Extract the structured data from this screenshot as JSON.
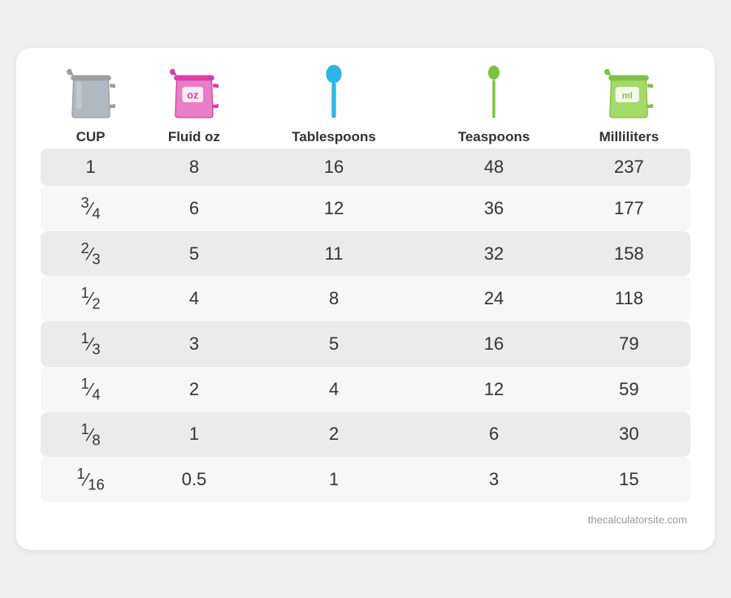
{
  "header": {
    "columns": [
      {
        "label": "CUP",
        "icon": "cup-icon"
      },
      {
        "label": "Fluid oz",
        "icon": "floz-icon"
      },
      {
        "label": "Tablespoons",
        "icon": "tablespoon-icon"
      },
      {
        "label": "Teaspoons",
        "icon": "teaspoon-icon"
      },
      {
        "label": "Milliliters",
        "icon": "milliliters-icon"
      }
    ]
  },
  "rows": [
    {
      "cup": "1",
      "floz": "8",
      "tbsp": "16",
      "tsp": "48",
      "ml": "237"
    },
    {
      "cup": "¾",
      "floz": "6",
      "tbsp": "12",
      "tsp": "36",
      "ml": "177"
    },
    {
      "cup": "⅔",
      "floz": "5",
      "tbsp": "11",
      "tsp": "32",
      "ml": "158"
    },
    {
      "cup": "½",
      "floz": "4",
      "tbsp": "8",
      "tsp": "24",
      "ml": "118"
    },
    {
      "cup": "⅓",
      "floz": "3",
      "tbsp": "5",
      "tsp": "16",
      "ml": "79"
    },
    {
      "cup": "¼",
      "floz": "2",
      "tbsp": "4",
      "tsp": "12",
      "ml": "59"
    },
    {
      "cup": "⅛",
      "floz": "1",
      "tbsp": "2",
      "tsp": "6",
      "ml": "30"
    },
    {
      "cup": "¹⁄₁₆",
      "floz": "0.5",
      "tbsp": "1",
      "tsp": "3",
      "ml": "15"
    }
  ],
  "footer": "thecalculatorsite.com",
  "colors": {
    "cup_gray": "#9e9e9e",
    "floz_pink": "#d63fa5",
    "tbsp_blue": "#2eb5e8",
    "tsp_green": "#7dc242",
    "ml_green": "#7dc242",
    "row_odd": "#ebebeb",
    "row_even": "#f7f7f7"
  }
}
